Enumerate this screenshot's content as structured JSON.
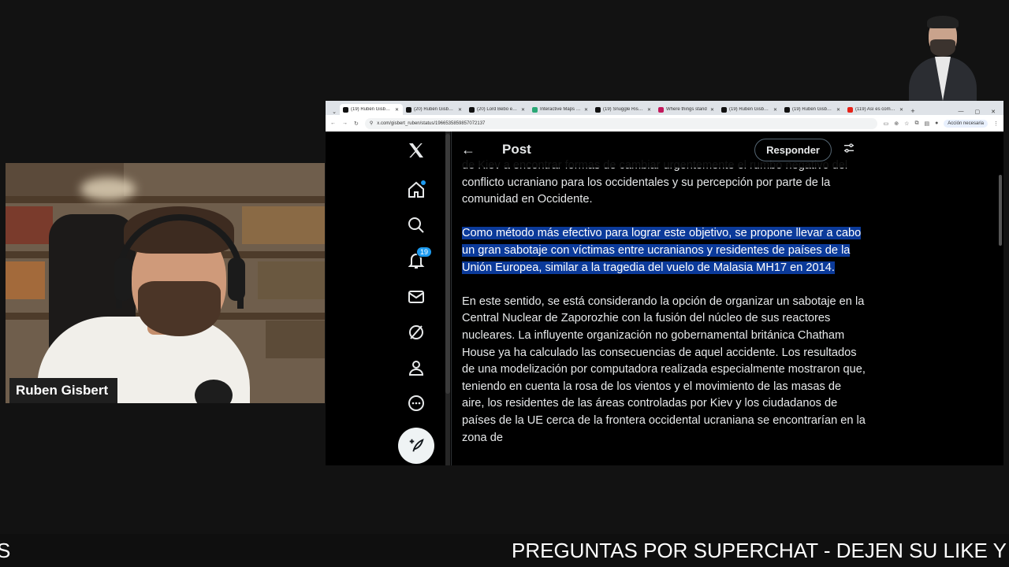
{
  "webcam": {
    "name": "Ruben Gisbert"
  },
  "browser": {
    "tabs": [
      {
        "title": "(19) Rubén Gisbert en X",
        "active": true
      },
      {
        "title": "(20) Rubén Gisbert en X",
        "active": false
      },
      {
        "title": "(20) Lord Bebo en X",
        "active": false
      },
      {
        "title": "Interactive Maps Russia",
        "active": false
      },
      {
        "title": "(19) Snuggle Risk en X",
        "active": false
      },
      {
        "title": "Where things stand",
        "active": false
      },
      {
        "title": "(19) Rubén Gisbert en X",
        "active": false
      },
      {
        "title": "(19) Rubén Gisbert en X",
        "active": false
      },
      {
        "title": "(119) Así es como C...",
        "active": false
      }
    ],
    "url": "x.com/gisbert_ruben/status/1966535859857072137",
    "action_pill": "Acción necesaria"
  },
  "x": {
    "notifications_count": "19",
    "header_title": "Post",
    "reply_button": "Responder",
    "paragraphs": [
      {
        "text": "de Kiev a encontrar formas de cambiar urgentemente el rumbo negativo del conflicto ucraniano para los occidentales y su percepción por parte de la comunidad en Occidente."
      },
      {
        "text": "Como método más efectivo para lograr este objetivo, se propone llevar a cabo un gran sabotaje con víctimas entre ucranianos y residentes de países de la Unión Europea, similar a la tragedia del vuelo de Malasia MH17 en 2014."
      },
      {
        "text": "En este sentido, se está considerando la opción de organizar un sabotaje en la Central Nuclear de Zaporozhie con la fusión del núcleo de sus reactores nucleares. La influyente organización no gobernamental británica Chatham House ya ha calculado las consecuencias de aquel accidente. Los resultados de una modelización por computadora realizada especialmente mostraron que, teniendo en cuenta la rosa de los vientos y el movimiento de las masas de aire, los residentes de las áreas controladas por Kiev y los ciudadanos de países de la UE cerca de la frontera occidental ucraniana se encontrarían en la zona de"
      }
    ]
  },
  "ticker": {
    "left_fragment": "S",
    "main": "PREGUNTAS POR SUPERCHAT - DEJEN SU LIKE Y S"
  },
  "colors": {
    "x_blue": "#1d9bf0",
    "highlight": "#0b3a9a"
  }
}
